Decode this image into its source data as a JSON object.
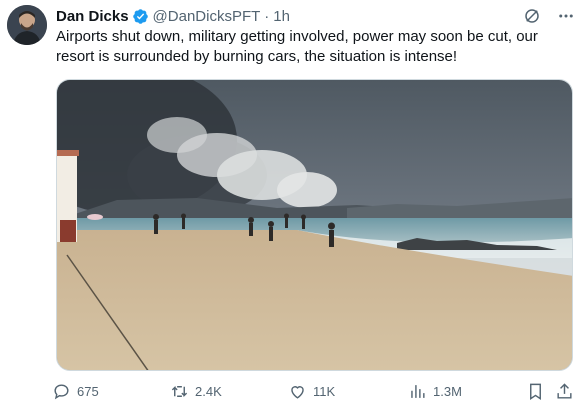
{
  "tweet": {
    "author_name": "Dan Dicks",
    "handle": "@DanDicksPFT",
    "separator": "·",
    "time": "1h",
    "text": "Airports shut down, military getting involved, power may soon be cut, our resort is surrounded by burning cars, the situation is intense!"
  },
  "actions": {
    "replies": "675",
    "reposts": "2.4K",
    "likes": "11K",
    "views": "1.3M"
  },
  "icons": {
    "verified": "verified-badge-icon",
    "grok": "grok-icon",
    "more": "more-icon",
    "reply": "reply-icon",
    "repost": "repost-icon",
    "like": "heart-icon",
    "views": "views-icon",
    "bookmark": "bookmark-icon",
    "share": "share-icon"
  },
  "colors": {
    "verified": "#1d9bf0",
    "secondary_text": "#536471"
  }
}
